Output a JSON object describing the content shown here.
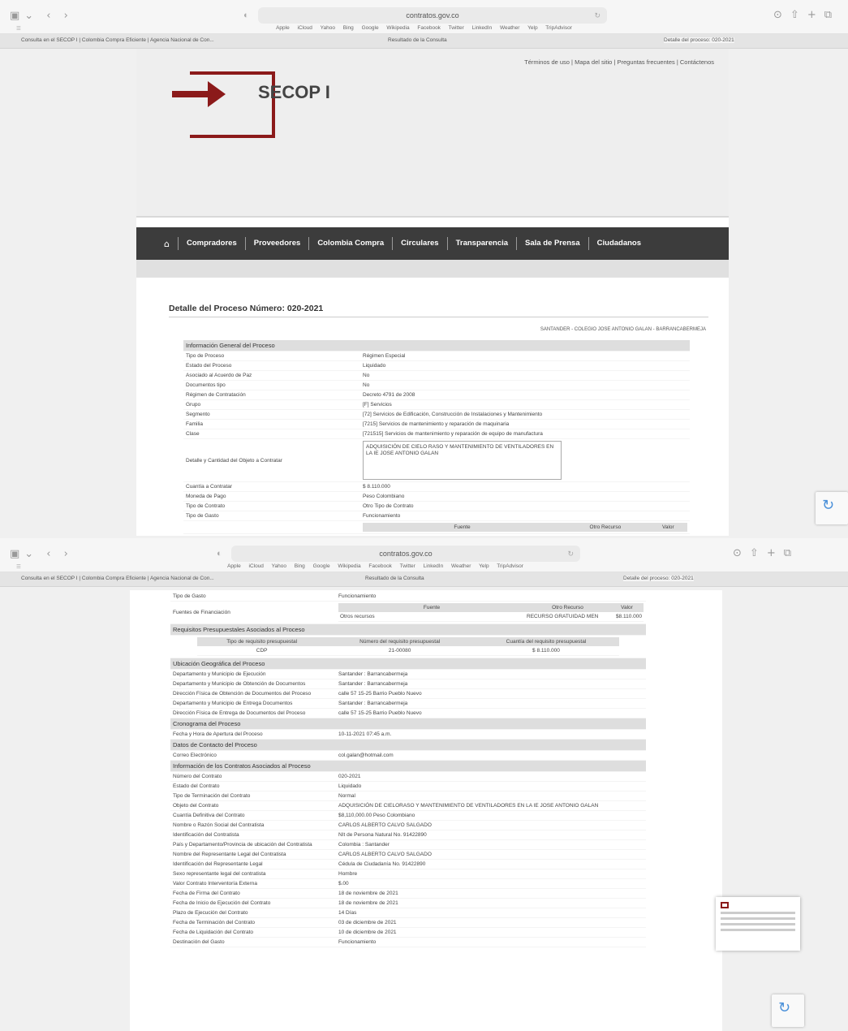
{
  "browser": {
    "url": "contratos.gov.co",
    "favorites": [
      "Apple",
      "iCloud",
      "Yahoo",
      "Bing",
      "Google",
      "Wikipedia",
      "Facebook",
      "Twitter",
      "LinkedIn",
      "Weather",
      "Yelp",
      "TripAdvisor"
    ],
    "tabs": [
      "Consulta en el SECOP I | Colombia Compra Eficiente | Agencia Nacional de Con...",
      "Resultado de la Consulta",
      "Detalle del proceso: 020-2021"
    ]
  },
  "header": {
    "top_links": "Términos de uso | Mapa del sitio | Preguntas frecuentes | Contáctenos",
    "logo_text": "SECOP I"
  },
  "nav": [
    "Compradores",
    "Proveedores",
    "Colombia Compra",
    "Circulares",
    "Transparencia",
    "Sala de Prensa",
    "Ciudadanos"
  ],
  "page_title": "Detalle del Proceso Número: 020-2021",
  "entity": "SANTANDER - COLEGIO JOSE ANTONIO GALAN - BARRANCABERMEJA",
  "general": {
    "title": "Información General del Proceso",
    "rows": [
      [
        "Tipo de Proceso",
        "Régimen Especial"
      ],
      [
        "Estado del Proceso",
        "Liquidado"
      ],
      [
        "Asociado al Acuerdo de Paz",
        "No"
      ],
      [
        "Documentos tipo",
        "No"
      ],
      [
        "Régimen de Contratación",
        "Decreto 4791 de 2008"
      ],
      [
        "Grupo",
        "[F] Servicios"
      ],
      [
        "Segmento",
        "[72] Servicios de Edificación, Construcción de Instalaciones y Mantenimiento"
      ],
      [
        "Familia",
        "[7215] Servicios de mantenimiento y reparación de maquinaria"
      ],
      [
        "Clase",
        "[721515] Servicios de mantenimiento y reparación de equipo de manufactura"
      ]
    ],
    "object_label": "Detalle y Cantidad del Objeto a Contratar",
    "object_value": "ADQUISICIÓN DE CIELO RASO Y MANTENIMIENTO DE VENTILADORES EN LA IE JOSE ANTONIO GALAN",
    "rows2": [
      [
        "Cuantía a Contratar",
        "$ 8.110.000"
      ],
      [
        "Moneda de Pago",
        "Peso Colombiano"
      ],
      [
        "Tipo de Contrato",
        "Otro Tipo de Contrato"
      ],
      [
        "Tipo de Gasto",
        "Funcionamiento"
      ]
    ],
    "funding_label": "Fuentes de Financiación",
    "funding_headers": [
      "Fuente",
      "Otro Recurso",
      "Valor"
    ],
    "funding_row": [
      "Otros recursos",
      "RECURSO GRATUIDAD MEN",
      "$8.110.000"
    ]
  },
  "budget": {
    "title": "Requisitos Presupuestales Asociados al Proceso",
    "headers": [
      "Tipo de requisito presupuestal",
      "Número del requisito presupuestal",
      "Cuantía del requisito presupuestal"
    ],
    "row": [
      "CDP",
      "21-00080",
      "$ 8.110.000"
    ]
  },
  "location": {
    "title": "Ubicación Geográfica del Proceso",
    "rows": [
      [
        "Departamento y Municipio de Ejecución",
        "Santander : Barrancabermeja"
      ],
      [
        "Departamento y Municipio de Obtención de Documentos",
        "Santander : Barrancabermeja"
      ],
      [
        "Dirección Física de Obtención de Documentos del Proceso",
        "calle 57 15-25 Barrio Pueblo Nuevo"
      ],
      [
        "Departamento y Municipio de Entrega Documentos",
        "Santander : Barrancabermeja"
      ],
      [
        "Dirección Física de Entrega de Documentos del Proceso",
        "calle 57 15-25 Barrio Pueblo Nuevo"
      ]
    ]
  },
  "schedule": {
    "title": "Cronograma del Proceso",
    "rows": [
      [
        "Fecha y Hora de Apertura del Proceso",
        "10-11-2021 07:45 a.m."
      ]
    ]
  },
  "contact": {
    "title": "Datos de Contacto del Proceso",
    "rows": [
      [
        "Correo Electrónico",
        "col.galan@hotmail.com"
      ]
    ]
  },
  "contracts": {
    "title": "Información de los Contratos Asociados al Proceso",
    "rows": [
      [
        "Número del Contrato",
        "020-2021"
      ],
      [
        "Estado del Contrato",
        "Liquidado"
      ],
      [
        "Tipo de Terminación del Contrato",
        "Normal"
      ],
      [
        "Objeto del Contrato",
        "ADQUISICIÓN DE CIELORASO Y MANTENIMIENTO DE VENTILADORES EN LA IE JOSE ANTONIO GALAN"
      ],
      [
        "Cuantía Definitiva del Contrato",
        "$8,110,000.00 Peso Colombiano"
      ],
      [
        "Nombre o Razón Social del Contratista",
        "CARLOS ALBERTO CALVO SALGADO"
      ],
      [
        "Identificación del Contratista",
        "NIt de Persona Natural No. 91422890"
      ],
      [
        "País y Departamento/Provincia de ubicación del Contratista",
        "Colombia : Santander"
      ],
      [
        "Nombre del Representante Legal del Contratista",
        "CARLOS ALBERTO CALVO SALGADO"
      ],
      [
        "Identificación del Representante Legal",
        "Cédula de Ciudadanía No. 91422890"
      ],
      [
        "Sexo representante legal del contratista",
        "Hombre"
      ],
      [
        "Valor Contrato Interventoría Externa",
        "$.00"
      ],
      [
        "Fecha de Firma del Contrato",
        "18 de noviembre de 2021"
      ],
      [
        "Fecha de Inicio de Ejecución del Contrato",
        "18 de noviembre de 2021"
      ],
      [
        "Plazo de Ejecución del Contrato",
        "14 Días"
      ],
      [
        "Fecha de Terminación del Contrato",
        "03 de diciembre de 2021"
      ],
      [
        "Fecha de Liquidación del Contrato",
        "10 de diciembre de 2021"
      ],
      [
        "Destinación del Gasto",
        "Funcionamiento"
      ]
    ]
  }
}
